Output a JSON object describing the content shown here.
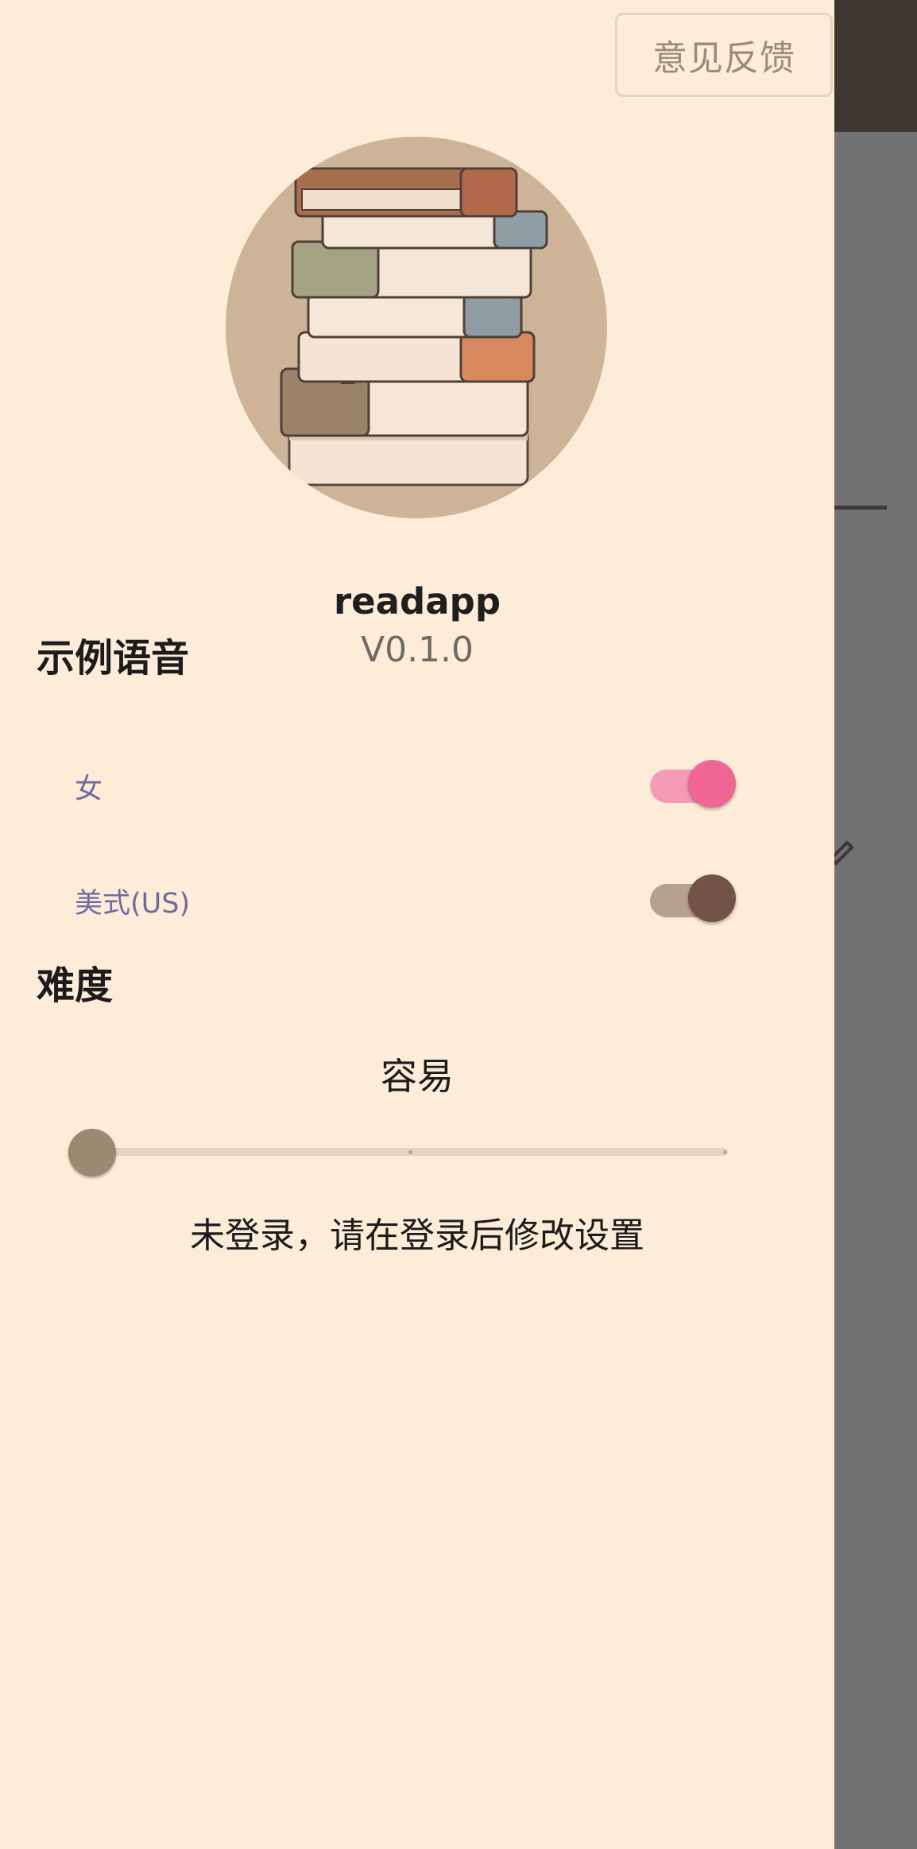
{
  "header": {
    "feedback_label": "意见反馈"
  },
  "profile": {
    "app_name": "readapp",
    "version": "V0.1.0",
    "avatar_icon": "book-stack-icon"
  },
  "voice": {
    "title": "示例语音",
    "options": [
      {
        "label": "女",
        "on": true,
        "color": "#f06593"
      },
      {
        "label": "美式(US)",
        "on": true,
        "color": "#735348"
      }
    ]
  },
  "difficulty": {
    "title": "难度",
    "value_label": "容易",
    "slider": {
      "min": 0,
      "max": 2,
      "value": 0
    }
  },
  "login_note": "未登录，请在登录后修改设置"
}
